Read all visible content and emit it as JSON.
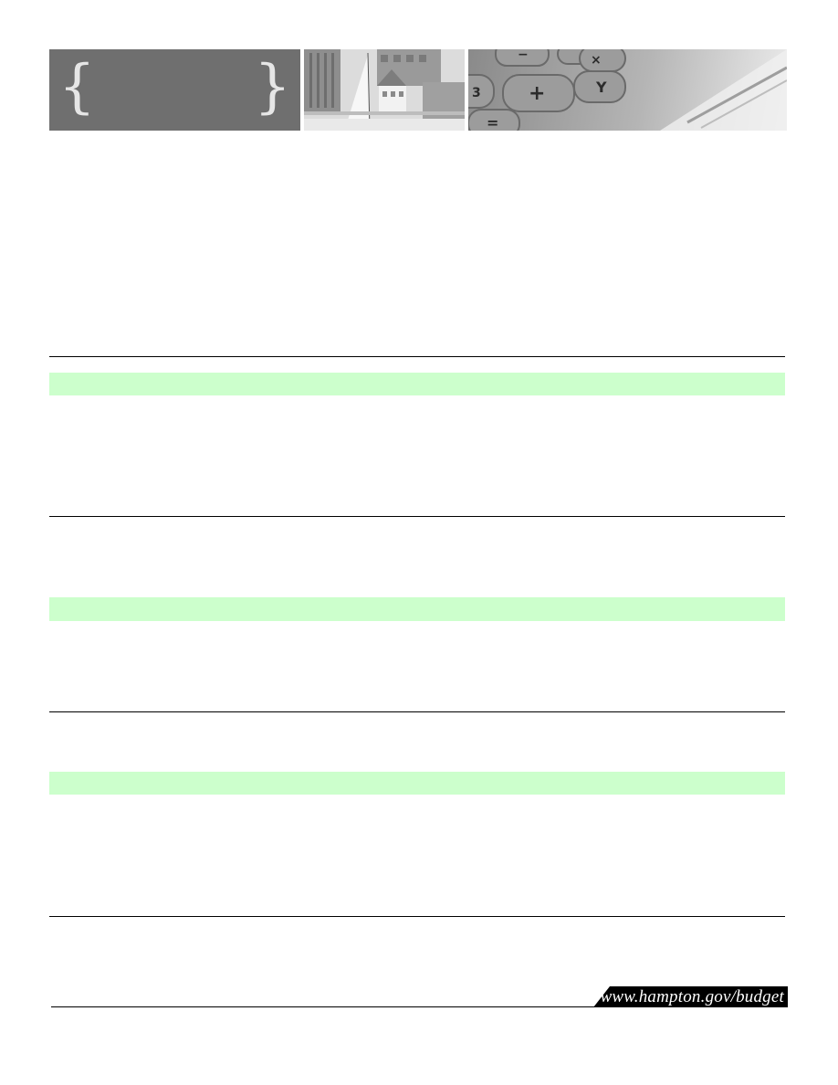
{
  "header": {
    "title_panel": {
      "left_brace": "{",
      "right_brace": "}"
    }
  },
  "sections": [
    {
      "band_color": "#ccffcc"
    },
    {
      "band_color": "#ccffcc"
    },
    {
      "band_color": "#ccffcc"
    }
  ],
  "footer": {
    "url": "www.hampton.gov/budget"
  }
}
